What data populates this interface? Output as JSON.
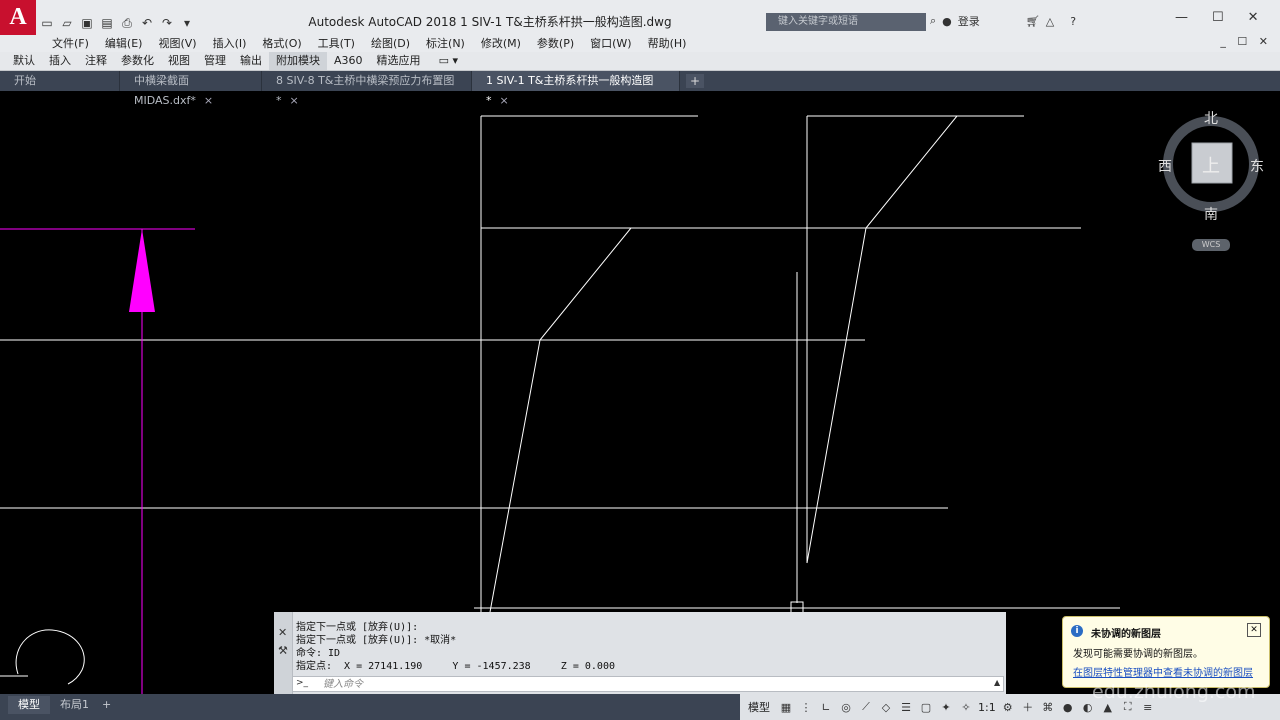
{
  "window": {
    "logo": "A",
    "title": "Autodesk AutoCAD 2018     1   SIV-1   T&主桥系杆拱一般构造图.dwg",
    "search_placeholder": "键入关键字或短语",
    "login_label": "登录",
    "help_label": "?",
    "minimize": "—",
    "maximize": "☐",
    "close": "✕"
  },
  "menubar": {
    "items": [
      "文件(F)",
      "编辑(E)",
      "视图(V)",
      "插入(I)",
      "格式(O)",
      "工具(T)",
      "绘图(D)",
      "标注(N)",
      "修改(M)",
      "参数(P)",
      "窗口(W)",
      "帮助(H)"
    ],
    "right_controls": "_ ☐ ✕"
  },
  "ribbon": {
    "tabs": [
      "默认",
      "插入",
      "注释",
      "参数化",
      "视图",
      "管理",
      "输出",
      "附加模块",
      "A360",
      "精选应用"
    ],
    "active_index": 7
  },
  "doc_tabs": {
    "items": [
      {
        "label": "开始",
        "closable": false
      },
      {
        "label": "中横梁截面MIDAS.dxf*",
        "closable": true
      },
      {
        "label": "8   SIV-8   T&主桥中横梁预应力布置图*",
        "closable": true
      },
      {
        "label": "1   SIV-1   T&主桥系杆拱一般构造图*",
        "closable": true
      }
    ],
    "active_index": 3,
    "add_label": "+"
  },
  "viewcube": {
    "north": "北",
    "south": "南",
    "east": "东",
    "west": "西",
    "face": "上",
    "wcs_label": "WCS"
  },
  "command": {
    "lines": [
      "指定下一点或 [放弃(U)]:",
      "指定下一点或 [放弃(U)]: *取消*",
      "命令: ID",
      "指定点:  X = 27141.190     Y = -1457.238     Z = 0.000"
    ],
    "input_placeholder": "键入命令",
    "prompt_icon": ">_"
  },
  "notification": {
    "title": "未协调的新图层",
    "message": "发现可能需要协调的新图层。",
    "link": "在图层特性管理器中查看未协调的新图层",
    "close": "✕"
  },
  "layout_tabs": {
    "items": [
      "模型",
      "布局1"
    ],
    "active_index": 0,
    "add_label": "+"
  },
  "statusbar": {
    "model_label": "模型",
    "scale_label": "1:1"
  },
  "watermark": "edu.zhulong.com",
  "colors": {
    "canvas": "#000000",
    "drawing_line": "#ffffff",
    "magenta": "#ff00ff",
    "title_bar": "#e9ebee",
    "tab_bar": "#3b4453"
  }
}
